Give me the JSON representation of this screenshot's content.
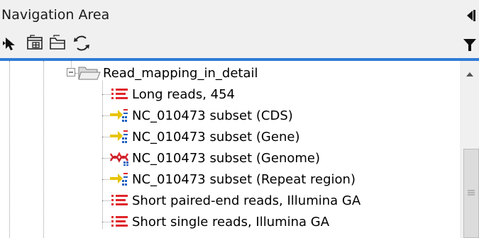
{
  "header": {
    "title": "Navigation Area"
  },
  "toolbar": {
    "buttons": [
      "select-pointer-icon",
      "add-folder-icon",
      "folder-icon",
      "refresh-icon"
    ],
    "filter_icon": "filter-icon"
  },
  "tree": {
    "folder": {
      "label": "Read_mapping_in_detail",
      "expanded": true
    },
    "items": [
      {
        "label": "Long reads, 454",
        "icon": "sequence-list-icon"
      },
      {
        "label": "NC_010473 subset (CDS)",
        "icon": "read-mapping-icon"
      },
      {
        "label": "NC_010473 subset (Gene)",
        "icon": "read-mapping-icon"
      },
      {
        "label": "NC_010473 subset (Genome)",
        "icon": "genome-mapping-icon"
      },
      {
        "label": "NC_010473 subset (Repeat region)",
        "icon": "read-mapping-icon"
      },
      {
        "label": "Short paired-end reads, Illumina GA",
        "icon": "sequence-list-icon"
      },
      {
        "label": "Short single reads, Illumina GA",
        "icon": "sequence-list-icon"
      }
    ]
  },
  "colors": {
    "accent": "#2f7bd6",
    "header_bg": "#f0f0f0",
    "list_red": "#e0262a",
    "mapping_yellow": "#e8c400",
    "mapping_blue": "#1f5fbf"
  }
}
